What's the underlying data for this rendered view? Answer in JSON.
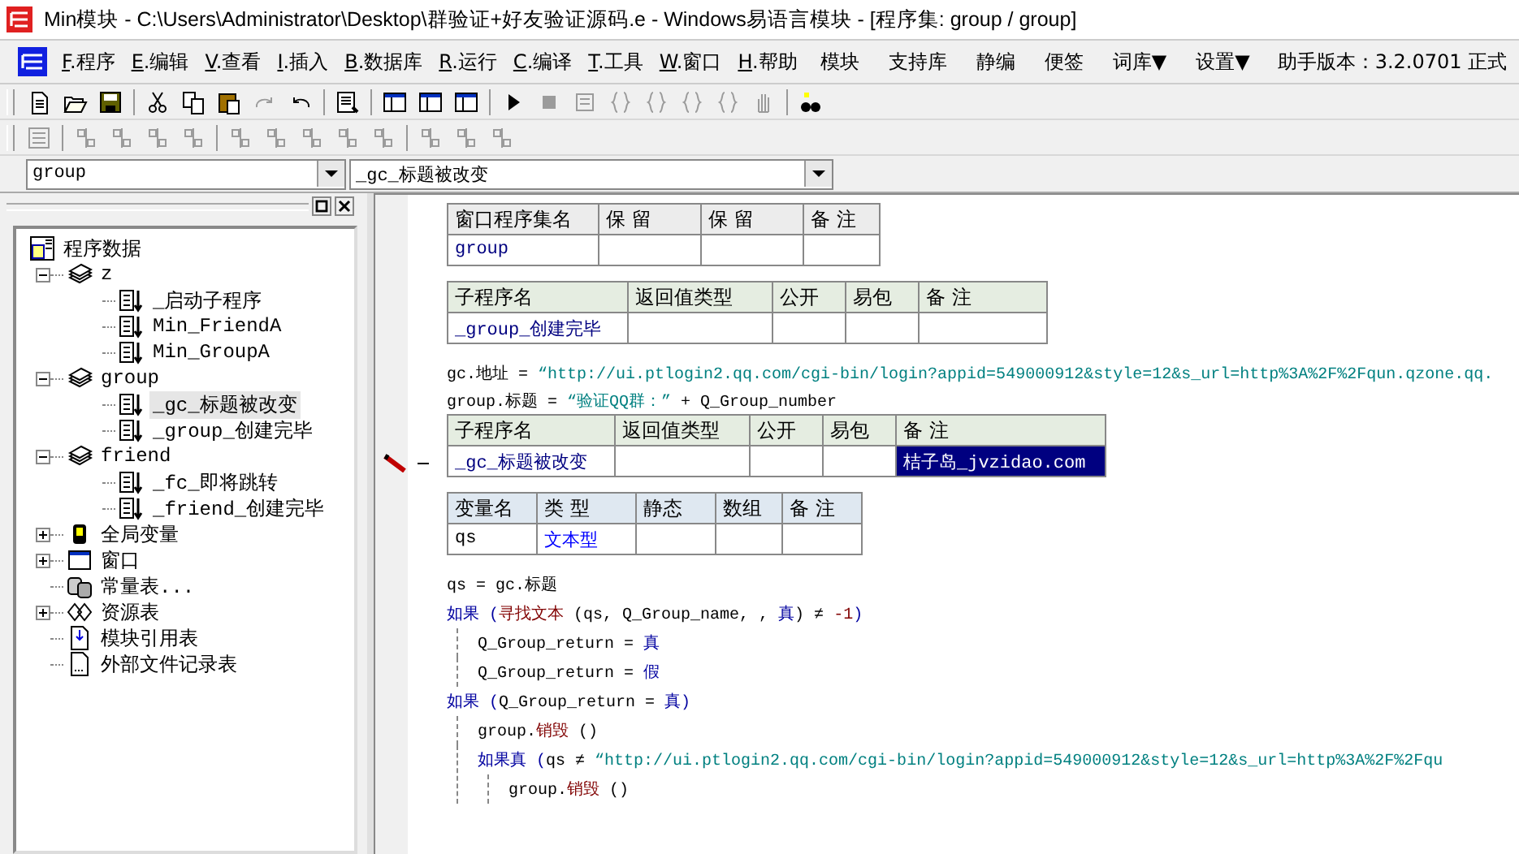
{
  "window": {
    "title": "Min模块 - C:\\Users\\Administrator\\Desktop\\群验证+好友验证源码.e - Windows易语言模块 - [程序集: group / group]"
  },
  "menu": [
    {
      "label": "F.程序",
      "kind": "accelerator"
    },
    {
      "label": "E.编辑",
      "kind": "accelerator"
    },
    {
      "label": "V.查看",
      "kind": "accelerator"
    },
    {
      "label": "I.插入",
      "kind": "accelerator"
    },
    {
      "label": "B.数据库",
      "kind": "accelerator"
    },
    {
      "label": "R.运行",
      "kind": "accelerator"
    },
    {
      "label": "C.编译",
      "kind": "accelerator"
    },
    {
      "label": "T.工具",
      "kind": "accelerator"
    },
    {
      "label": "W.窗口",
      "kind": "accelerator"
    },
    {
      "label": "H.帮助",
      "kind": "accelerator"
    },
    {
      "label": "模块",
      "kind": "plain"
    },
    {
      "label": "支持库",
      "kind": "plain"
    },
    {
      "label": "静编",
      "kind": "plain"
    },
    {
      "label": "便签",
      "kind": "plain"
    },
    {
      "label": "词库▼",
      "kind": "plain"
    },
    {
      "label": "设置▼",
      "kind": "plain"
    },
    {
      "label": "助手版本：3.2.0701 正式",
      "kind": "info"
    }
  ],
  "toolbars": [
    {
      "items": [
        {
          "kind": "button",
          "disabled": false
        },
        {
          "kind": "button",
          "disabled": false
        },
        {
          "kind": "button",
          "disabled": false
        },
        {
          "kind": "separator"
        },
        {
          "kind": "button",
          "disabled": false
        },
        {
          "kind": "button",
          "disabled": false
        },
        {
          "kind": "button",
          "disabled": false
        },
        {
          "kind": "button",
          "disabled": true
        },
        {
          "kind": "button",
          "disabled": false
        },
        {
          "kind": "separator"
        },
        {
          "kind": "button",
          "disabled": false
        },
        {
          "kind": "separator"
        },
        {
          "kind": "button",
          "disabled": false
        },
        {
          "kind": "button",
          "disabled": false
        },
        {
          "kind": "button",
          "disabled": false
        },
        {
          "kind": "separator"
        },
        {
          "kind": "button",
          "disabled": false
        },
        {
          "kind": "button",
          "disabled": true
        },
        {
          "kind": "button",
          "disabled": true
        },
        {
          "kind": "button",
          "disabled": true
        },
        {
          "kind": "button",
          "disabled": true
        },
        {
          "kind": "button",
          "disabled": true
        },
        {
          "kind": "button",
          "disabled": true
        },
        {
          "kind": "button",
          "disabled": true
        },
        {
          "kind": "separator"
        },
        {
          "kind": "button",
          "disabled": false
        }
      ]
    },
    {
      "items": [
        {
          "kind": "button",
          "disabled": true
        },
        {
          "kind": "separator"
        },
        {
          "kind": "button",
          "disabled": true
        },
        {
          "kind": "button",
          "disabled": true
        },
        {
          "kind": "button",
          "disabled": true
        },
        {
          "kind": "button",
          "disabled": true
        },
        {
          "kind": "separator"
        },
        {
          "kind": "button",
          "disabled": true
        },
        {
          "kind": "button",
          "disabled": true
        },
        {
          "kind": "button",
          "disabled": true
        },
        {
          "kind": "button",
          "disabled": true
        },
        {
          "kind": "button",
          "disabled": true
        },
        {
          "kind": "separator"
        },
        {
          "kind": "button",
          "disabled": true
        },
        {
          "kind": "button",
          "disabled": true
        },
        {
          "kind": "button",
          "disabled": true
        }
      ]
    }
  ],
  "selectors": [
    {
      "value": "group"
    },
    {
      "value": "_gc_标题被改变"
    }
  ],
  "tree": [
    {
      "label": "程序数据",
      "kind": "program-data",
      "selected": false,
      "children": [
        {
          "label": "z",
          "kind": "assembly",
          "expanded": true,
          "selected": false,
          "children": [
            {
              "label": "_启动子程序",
              "kind": "sub",
              "selected": false
            },
            {
              "label": "Min_FriendA",
              "kind": "sub",
              "selected": false
            },
            {
              "label": "Min_GroupA",
              "kind": "sub",
              "selected": false
            }
          ]
        },
        {
          "label": "group",
          "kind": "assembly",
          "expanded": true,
          "selected": false,
          "children": [
            {
              "label": "_gc_标题被改变",
              "kind": "sub",
              "selected": true
            },
            {
              "label": "_group_创建完毕",
              "kind": "sub",
              "selected": false
            }
          ]
        },
        {
          "label": "friend",
          "kind": "assembly",
          "expanded": true,
          "selected": false,
          "children": [
            {
              "label": "_fc_即将跳转",
              "kind": "sub",
              "selected": false
            },
            {
              "label": "_friend_创建完毕",
              "kind": "sub",
              "selected": false
            }
          ]
        },
        {
          "label": "全局变量",
          "kind": "globals",
          "expanded": false,
          "selected": false
        },
        {
          "label": "窗口",
          "kind": "window",
          "expanded": false,
          "selected": false
        },
        {
          "label": "常量表...",
          "kind": "constants",
          "selected": false
        },
        {
          "label": "资源表",
          "kind": "resources",
          "expanded": false,
          "selected": false
        },
        {
          "label": "模块引用表",
          "kind": "module-ref",
          "selected": false
        },
        {
          "label": "外部文件记录表",
          "kind": "external-files",
          "selected": false
        }
      ]
    }
  ],
  "editor": [
    {
      "kind": "assembly_table",
      "columns": [
        "窗口程序集名",
        "保 留",
        "保 留",
        "备 注"
      ],
      "rows": [
        [
          {
            "text": "group",
            "selected": false
          },
          {
            "selected": false
          },
          {
            "selected": false
          },
          {
            "selected": false
          }
        ]
      ]
    },
    {
      "kind": "sub_table",
      "columns": [
        "子程序名",
        "返回值类型",
        "公开",
        "易包",
        "备 注"
      ],
      "rows": [
        [
          {
            "text": "_group_创建完毕",
            "selected": false
          },
          {
            "selected": false
          },
          {
            "selected": false
          },
          {
            "selected": false
          },
          {
            "selected": false
          }
        ]
      ]
    },
    {
      "kind": "line",
      "tokens": [
        {
          "kind": "plain",
          "text": "gc.地址 = "
        },
        {
          "kind": "string",
          "text": "“http://ui.ptlogin2.qq.com/cgi-bin/login?appid=549000912&style=12&s_url=http%3A%2F%2Fqun.qzone.qq."
        }
      ]
    },
    {
      "kind": "line",
      "tokens": [
        {
          "kind": "plain",
          "text": "group.标题 = "
        },
        {
          "kind": "string",
          "text": "“验证QQ群：”"
        },
        {
          "kind": "plain",
          "text": " + Q_Group_number"
        }
      ]
    },
    {
      "kind": "sub_table",
      "current": true,
      "columns": [
        "子程序名",
        "返回值类型",
        "公开",
        "易包",
        "备 注"
      ],
      "rows": [
        [
          {
            "text": "_gc_标题被改变",
            "selected": false
          },
          {
            "selected": false
          },
          {
            "selected": false
          },
          {
            "selected": false
          },
          {
            "text": "桔子岛_jvzidao.com",
            "selected": true
          }
        ]
      ]
    },
    {
      "kind": "variable_table",
      "columns": [
        "变量名",
        "类 型",
        "静态",
        "数组",
        "备 注"
      ],
      "rows": [
        [
          {
            "text": "qs",
            "selected": false
          },
          {
            "text": "文本型",
            "selected": false
          },
          {
            "selected": false
          },
          {
            "selected": false
          },
          {
            "selected": false
          }
        ]
      ]
    },
    {
      "kind": "code",
      "statements": [
        {
          "kind": "line",
          "tokens": [
            {
              "kind": "plain",
              "text": "qs = gc.标题"
            }
          ]
        },
        {
          "kind": "if",
          "tokens": [
            {
              "kind": "keyword",
              "text": "如果 ("
            },
            {
              "kind": "function",
              "text": "寻找文本"
            },
            {
              "kind": "plain",
              "text": " (qs, Q_Group_name, , "
            },
            {
              "kind": "keyword",
              "text": "真"
            },
            {
              "kind": "plain",
              "text": ") ≠ "
            },
            {
              "kind": "number",
              "text": "-1"
            },
            {
              "kind": "keyword",
              "text": ")"
            }
          ],
          "then": [
            {
              "kind": "line",
              "tokens": [
                {
                  "kind": "plain",
                  "text": "Q_Group_return = "
                },
                {
                  "kind": "keyword",
                  "text": "真"
                }
              ]
            }
          ],
          "else": [
            {
              "kind": "line",
              "tokens": [
                {
                  "kind": "plain",
                  "text": "Q_Group_return = "
                },
                {
                  "kind": "keyword",
                  "text": "假"
                }
              ]
            }
          ]
        },
        {
          "kind": "if",
          "tokens": [
            {
              "kind": "keyword",
              "text": "如果 ("
            },
            {
              "kind": "plain",
              "text": "Q_Group_return = "
            },
            {
              "kind": "keyword",
              "text": "真)"
            }
          ],
          "then": [
            {
              "kind": "line",
              "tokens": [
                {
                  "kind": "plain",
                  "text": "group."
                },
                {
                  "kind": "function",
                  "text": "销毁"
                },
                {
                  "kind": "plain",
                  "text": " ()"
                }
              ]
            }
          ],
          "else": [
            {
              "kind": "if_true",
              "tokens": [
                {
                  "kind": "keyword",
                  "text": "如果真 ("
                },
                {
                  "kind": "plain",
                  "text": "qs ≠ "
                },
                {
                  "kind": "string",
                  "text": "“http://ui.ptlogin2.qq.com/cgi-bin/login?appid=549000912&style=12&s_url=http%3A%2F%2Fqu"
                }
              ],
              "then": [
                {
                  "kind": "line",
                  "tokens": [
                    {
                      "kind": "plain",
                      "text": "group."
                    },
                    {
                      "kind": "function",
                      "text": "销毁"
                    },
                    {
                      "kind": "plain",
                      "text": " ()"
                    }
                  ]
                }
              ]
            }
          ]
        }
      ]
    }
  ]
}
